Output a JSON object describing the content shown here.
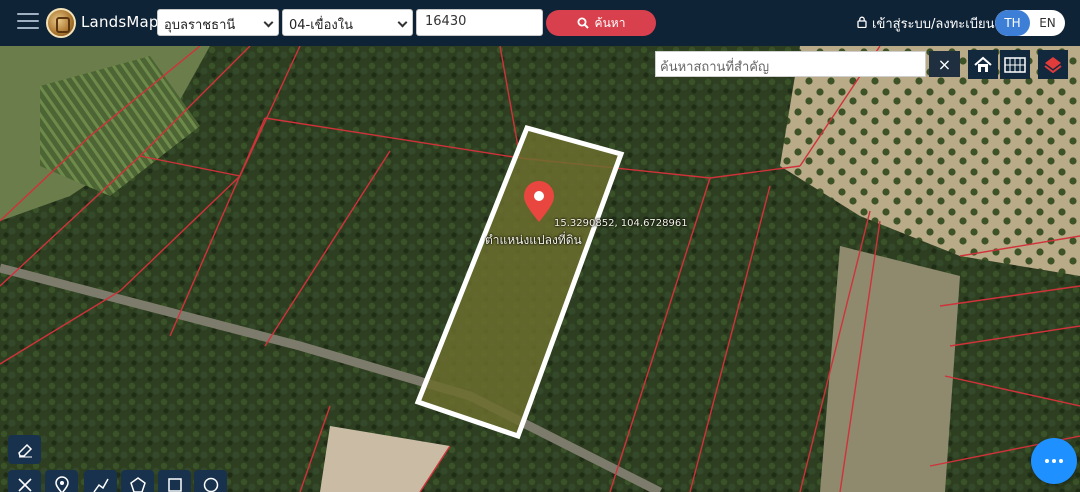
{
  "header": {
    "brand": "LandsMaps",
    "province": "อุบลราชธานี",
    "district": "04-เขื่องใน",
    "parcel_number": "16430",
    "search_label": "ค้นหา",
    "login_label": "เข้าสู่ระบบ/ลงทะเบียน",
    "lang_th": "TH",
    "lang_en": "EN",
    "active_lang": "TH"
  },
  "map": {
    "place_search_placeholder": "ค้นหาสถานที่สำคัญ",
    "clear_symbol": "×",
    "pin_label": "ตำแหน่งแปลงที่ดิน",
    "coordinates": "15.3290852, 104.6728961",
    "controls": [
      "home-icon",
      "grid-icon",
      "layers-icon"
    ],
    "tools": [
      "eraser-icon",
      "measure-icon",
      "pin-icon",
      "line-icon",
      "polygon-icon",
      "rectangle-icon",
      "circle-icon"
    ]
  },
  "colors": {
    "topbar": "#0f2336",
    "search_button": "#d9404e",
    "lang_active": "#3d7fd7",
    "parcel_outline": "#ffffff",
    "boundary_lines": "#d0323a",
    "pin": "#e8463f",
    "fab": "#1e90ff"
  }
}
